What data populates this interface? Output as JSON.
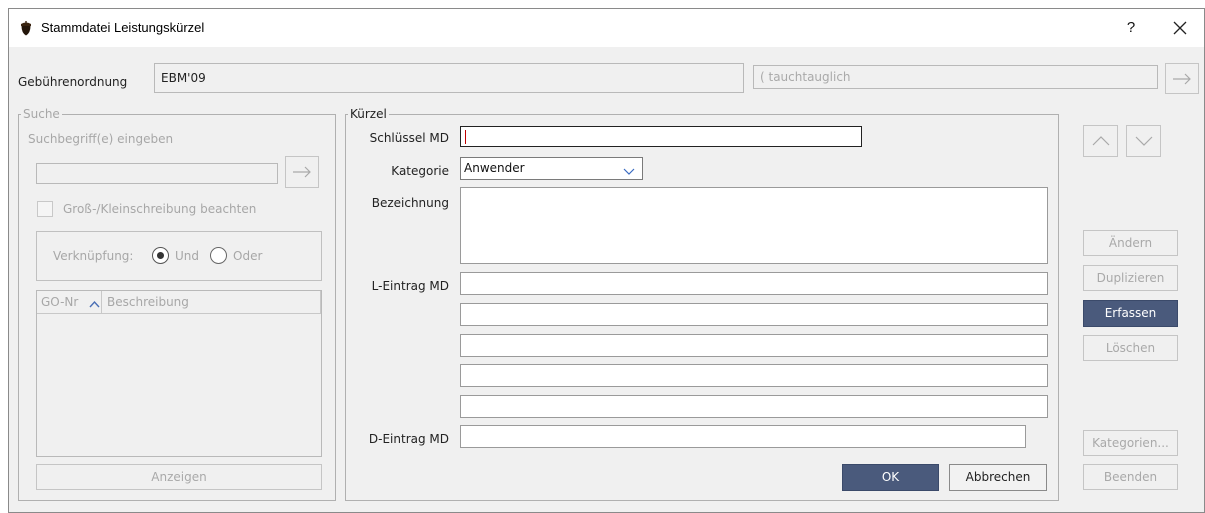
{
  "window": {
    "title": "Stammdatei Leistungskürzel",
    "help_label": "?"
  },
  "header": {
    "gebuehrenordnung_label": "Gebührenordnung",
    "gebuehrenordnung_value": "EBM'09",
    "tauchtauglich_value": "( tauchtauglich"
  },
  "suche": {
    "title": "Suche",
    "hint": "Suchbegriff(e) eingeben",
    "input_value": "",
    "case_label": "Groß-/Kleinschreibung beachten",
    "verknuepfung_label": "Verknüpfung:",
    "radio_und": "Und",
    "radio_oder": "Oder",
    "selected": "Und",
    "columns": [
      "GO-Nr",
      "Beschreibung"
    ],
    "anzeigen_label": "Anzeigen"
  },
  "kuerzel": {
    "title": "Kürzel",
    "schluessel_label": "Schlüssel MD",
    "schluessel_value": "",
    "kategorie_label": "Kategorie",
    "kategorie_value": "Anwender",
    "bezeichnung_label": "Bezeichnung",
    "bezeichnung_value": "",
    "l_eintrag_label": "L-Eintrag MD",
    "l_eintrag_values": [
      "",
      "",
      "",
      "",
      ""
    ],
    "d_eintrag_label": "D-Eintrag MD",
    "d_eintrag_value": "",
    "ok_label": "OK",
    "abbrechen_label": "Abbrechen"
  },
  "actions": {
    "aendern": "Ändern",
    "duplizieren": "Duplizieren",
    "erfassen": "Erfassen",
    "loeschen": "Löschen",
    "kategorien": "Kategorien...",
    "beenden": "Beenden"
  },
  "colors": {
    "primary_button": "#4a5a7c",
    "window_bg": "#f0f0f0",
    "caret": "#c00000"
  },
  "icons": {
    "app": "acorn-icon",
    "close": "close-icon",
    "arrow": "arrow-right-icon",
    "up": "chevron-up-icon",
    "down": "chevron-down-icon"
  }
}
